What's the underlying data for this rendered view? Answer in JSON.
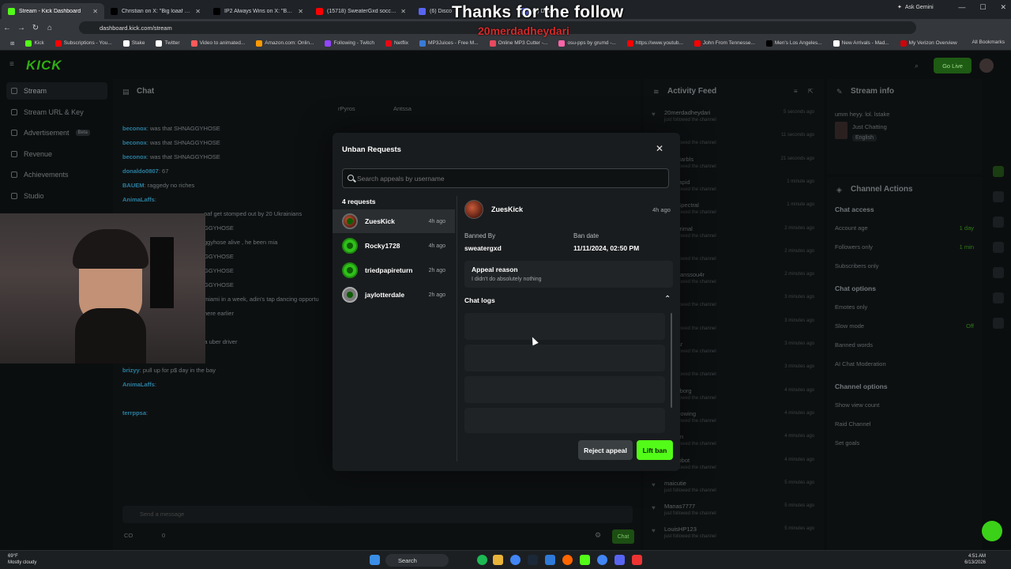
{
  "browser": {
    "tabs": [
      {
        "label": "Stream - Kick Dashboard",
        "color": "#53fc18",
        "active": true
      },
      {
        "label": "Christian on X: \"Big loaaf gets jt",
        "color": "#000000"
      },
      {
        "label": "IP2 Always Wins on X: \"Burt Bro",
        "color": "#000000"
      },
      {
        "label": "(15718) SweaterGxd soccer hig",
        "color": "#ff0000"
      },
      {
        "label": "(6) Disco",
        "color": "#5865f2"
      },
      {
        "label": "(6) Disco",
        "color": "#5865f2"
      }
    ],
    "ask_gemini": "Ask Gemini",
    "url": "dashboard.kick.com/stream",
    "bookmarks": [
      {
        "label": "Kick",
        "color": "#53fc18"
      },
      {
        "label": "Subscriptions - You...",
        "color": "#ff0000"
      },
      {
        "label": "Stake",
        "color": "#ffffff"
      },
      {
        "label": "Twitter",
        "color": "#ffffff"
      },
      {
        "label": "Video to animated...",
        "color": "#ff5a5a"
      },
      {
        "label": "Amazon.com: Onlin...",
        "color": "#ff9900"
      },
      {
        "label": "Following - Twitch",
        "color": "#9146ff"
      },
      {
        "label": "Netflix",
        "color": "#e50914"
      },
      {
        "label": "MP3Juices - Free M...",
        "color": "#3a7bd5"
      },
      {
        "label": "Online MP3 Cutter -...",
        "color": "#e84a5f"
      },
      {
        "label": "osu-pps by grumd -...",
        "color": "#ff66aa"
      },
      {
        "label": "https://www.youtub...",
        "color": "#ff0000"
      },
      {
        "label": "John From Tennesse...",
        "color": "#ff0000"
      },
      {
        "label": "Men's Los Angeles...",
        "color": "#000000"
      },
      {
        "label": "New Arrivals - Mad...",
        "color": "#ffffff"
      },
      {
        "label": "My Verizon Overview",
        "color": "#cd040b"
      }
    ],
    "all_bookmarks": "All Bookmarks"
  },
  "overlay": {
    "title": "Thanks for the follow",
    "name": "20merdadheydari"
  },
  "dashboard": {
    "go_live": "Go Live",
    "sidebar": [
      {
        "label": "Stream",
        "active": true
      },
      {
        "label": "Stream URL & Key"
      },
      {
        "label": "Advertisement",
        "badge": "Beta"
      },
      {
        "label": "Revenue"
      },
      {
        "label": "Achievements"
      },
      {
        "label": "Studio"
      }
    ],
    "chat": {
      "title": "Chat",
      "pinned": [
        "rPyros",
        "Antssa"
      ],
      "lines": [
        {
          "user": "beconox",
          "text": "was that SHNAGGYHOSE"
        },
        {
          "user": "beconox",
          "text": "was that SHNAGGYHOSE"
        },
        {
          "user": "beconox",
          "text": "was that SHNAGGYHOSE"
        },
        {
          "user": "donaldo0807",
          "text": "67"
        },
        {
          "user": "BAUEM",
          "text": "raggedy no riches"
        },
        {
          "user": "AnimaLaffs",
          "text": ""
        },
        {
          "user": "",
          "text": "oaf get stomped out by 20 Ukrainians"
        },
        {
          "user": "",
          "text": "GGYHOSE"
        },
        {
          "user": "",
          "text": "ggyhose alive , he been mia"
        },
        {
          "user": "",
          "text": "GGYHOSE"
        },
        {
          "user": "",
          "text": "GGYHOSE"
        },
        {
          "user": "",
          "text": "GGYHOSE"
        },
        {
          "user": "",
          "text": "miami in a week, adin's tap dancing opportu"
        },
        {
          "user": "",
          "text": "here earlier"
        },
        {
          "user": "Ysipalne",
          "text": ""
        },
        {
          "user": "beconox",
          "text": "SHNAGGYHOSE is a uber driver"
        },
        {
          "user": "beconox",
          "text": ""
        },
        {
          "user": "brizyy",
          "text": "pull up for p$ day in the bay"
        },
        {
          "user": "AnimaLaffs",
          "text": ""
        },
        {
          "user": "",
          "text": ""
        },
        {
          "user": "terrppsa",
          "text": ""
        }
      ],
      "input_placeholder": "Send a message",
      "send": "Chat",
      "stats": [
        "CO",
        "0"
      ]
    },
    "activity": {
      "title": "Activity Feed",
      "items": [
        {
          "name": "20merdadheydari",
          "sub": "just followed the channel",
          "time": "5 seconds ago"
        },
        {
          "name": "...",
          "sub": "just followed the channel",
          "time": "11 seconds ago"
        },
        {
          "name": "...haMarbls",
          "sub": "just followed the channel",
          "time": "21 seconds ago"
        },
        {
          "name": "...erRapid",
          "sub": "just followed the channel",
          "time": "1 minute ago"
        },
        {
          "name": "...hinSpectral",
          "sub": "just followed the channel",
          "time": "1 minute ago"
        },
        {
          "name": "...baPrimal",
          "sub": "just followed the channel",
          "time": "2 minutes ago"
        },
        {
          "name": "...01",
          "sub": "just followed the channel",
          "time": "2 minutes ago"
        },
        {
          "name": "...allmanssou4r",
          "sub": "just followed the channel",
          "time": "2 minutes ago"
        },
        {
          "name": "...lad",
          "sub": "just followed the channel",
          "time": "3 minutes ago"
        },
        {
          "name": "...r33",
          "sub": "just followed the channel",
          "time": "3 minutes ago"
        },
        {
          "name": "...tunar",
          "sub": "just followed the channel",
          "time": "3 minutes ago"
        },
        {
          "name": "...5",
          "sub": "just followed the channel",
          "time": "3 minutes ago"
        },
        {
          "name": "...oCyborg",
          "sub": "just followed the channel",
          "time": "4 minutes ago"
        },
        {
          "name": "...erGlowing",
          "sub": "just followed the channel",
          "time": "4 minutes ago"
        },
        {
          "name": "...inson",
          "sub": "just followed the channel",
          "time": "4 minutes ago"
        },
        {
          "name": "...tyRobot",
          "sub": "just followed the channel",
          "time": "4 minutes ago"
        },
        {
          "name": "maicutie",
          "sub": "just followed the channel",
          "time": "5 minutes ago"
        },
        {
          "name": "Manas7777",
          "sub": "just followed the channel",
          "time": "5 minutes ago"
        },
        {
          "name": "LouisHP123",
          "sub": "just followed the channel",
          "time": "5 minutes ago"
        }
      ]
    },
    "stream_info": {
      "title": "Stream info",
      "stream_title": "umm heyy. lol. lstake",
      "category": "Just Chatting",
      "language": "English"
    },
    "channel_actions": {
      "title": "Channel Actions",
      "sections": [
        {
          "header": "Chat access",
          "rows": [
            {
              "label": "Account age",
              "value": "1 day"
            },
            {
              "label": "Followers only",
              "value": "1 min"
            },
            {
              "label": "Subscribers only",
              "value": ""
            }
          ]
        },
        {
          "header": "Chat options",
          "rows": [
            {
              "label": "Emotes only",
              "value": ""
            },
            {
              "label": "Slow mode",
              "value": "Off"
            },
            {
              "label": "Banned words",
              "value": ""
            },
            {
              "label": "AI Chat Moderation",
              "value": ""
            }
          ]
        },
        {
          "header": "Channel options",
          "rows": [
            {
              "label": "Show view count",
              "value": ""
            },
            {
              "label": "Raid Channel",
              "value": ""
            },
            {
              "label": "Set goals",
              "value": ""
            }
          ]
        }
      ]
    }
  },
  "modal": {
    "title": "Unban Requests",
    "search_placeholder": "Search appeals by username",
    "count_label": "4 requests",
    "requests": [
      {
        "name": "ZuesKick",
        "time": "4h ago",
        "active": true
      },
      {
        "name": "Rocky1728",
        "time": "4h ago"
      },
      {
        "name": "triedpapireturn",
        "time": "2h ago"
      },
      {
        "name": "jaylotterdale",
        "time": "2h ago"
      }
    ],
    "detail": {
      "name": "ZuesKick",
      "time": "4h ago",
      "banned_by_label": "Banned By",
      "banned_by": "sweatergxd",
      "ban_date_label": "Ban date",
      "ban_date": "11/11/2024, 02:50 PM",
      "appeal_label": "Appeal reason",
      "appeal_text": "I didn't do absolutely nothing",
      "chat_logs_label": "Chat logs"
    },
    "reject": "Reject appeal",
    "lift": "Lift ban"
  },
  "taskbar": {
    "weather_temp": "69°F",
    "weather_desc": "Mostly cloudy",
    "search": "Search",
    "time": "4:51 AM",
    "date": "6/13/2026"
  }
}
